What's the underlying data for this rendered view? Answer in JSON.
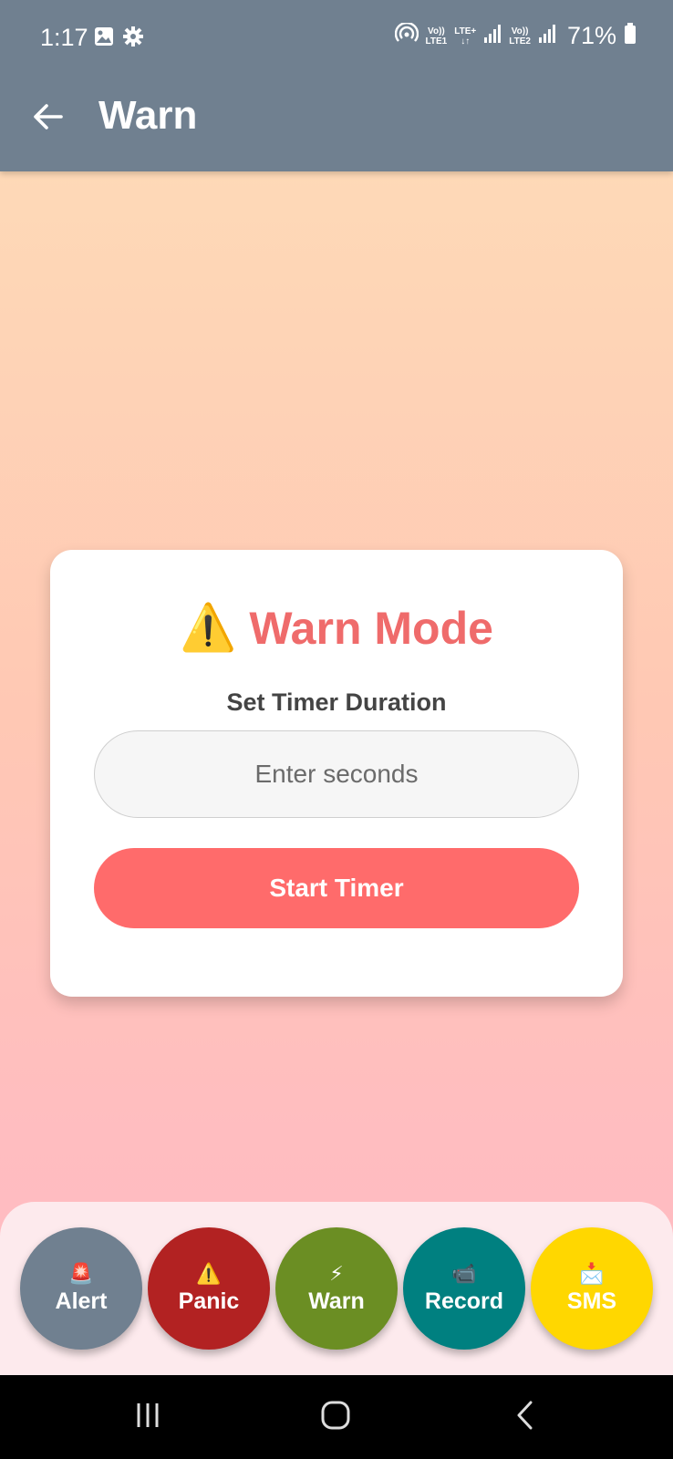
{
  "status_bar": {
    "time": "1:17",
    "sim1_top": "Vo))",
    "sim1_bottom": "LTE1",
    "net_top": "LTE+",
    "net_bottom": "↓↑",
    "sim2_top": "Vo))",
    "sim2_bottom": "LTE2",
    "battery": "71%",
    "icons": [
      "gallery-icon",
      "settings-gear-icon",
      "hotspot-icon",
      "signal-icon",
      "signal-icon",
      "battery-icon"
    ]
  },
  "app_bar": {
    "title": "Warn",
    "back_icon": "arrow-left-icon"
  },
  "card": {
    "icon": "⚠️",
    "title": "Warn Mode",
    "subtitle": "Set Timer Duration",
    "input_placeholder": "Enter seconds",
    "input_value": "",
    "button_label": "Start Timer"
  },
  "bottom_actions": [
    {
      "emoji": "🚨",
      "label": "Alert",
      "color": "#708090"
    },
    {
      "emoji": "⚠️",
      "label": "Panic",
      "color": "#b22222"
    },
    {
      "emoji": "⚡",
      "label": "Warn",
      "color": "#6b8e23"
    },
    {
      "emoji": "📹",
      "label": "Record",
      "color": "#008080"
    },
    {
      "emoji": "📩",
      "label": "SMS",
      "color": "#ffd700"
    }
  ],
  "colors": {
    "app_bar": "#708090",
    "accent": "#ff6b6b",
    "title_red": "#ef6b6b",
    "gradient_top": "#fed9b7",
    "gradient_bottom": "#ffbac3",
    "tray": "#fdeaed"
  },
  "nav_bar": {
    "icons": [
      "recents-icon",
      "home-icon",
      "back-chevron-icon"
    ]
  }
}
